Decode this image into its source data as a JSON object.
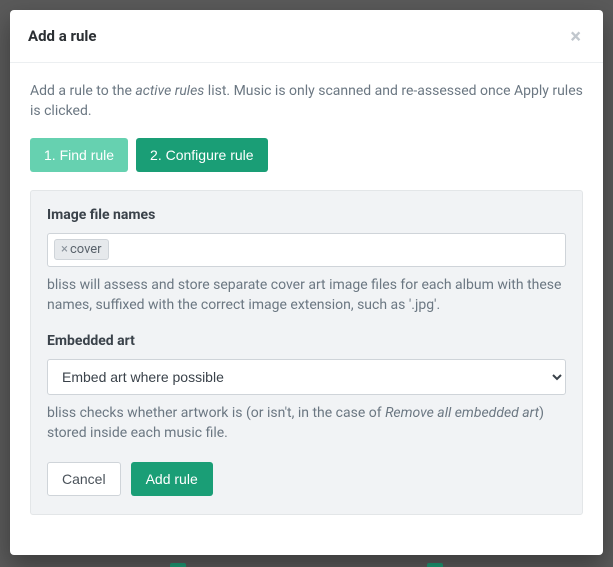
{
  "modal": {
    "title": "Add a rule",
    "close_symbol": "×",
    "intro_prefix": "Add a rule to the ",
    "intro_em": "active rules",
    "intro_suffix": " list. Music is only scanned and re-assessed once Apply rules is clicked."
  },
  "steps": {
    "find": "1. Find rule",
    "configure": "2. Configure rule"
  },
  "form": {
    "image_file_names_label": "Image file names",
    "image_file_names_token": "cover",
    "image_file_names_help": "bliss will assess and store separate cover art image files for each album with these names, suffixed with the correct image extension, such as '.jpg'.",
    "embedded_art_label": "Embedded art",
    "embedded_art_selected": "Embed art where possible",
    "embedded_art_help_prefix": "bliss checks whether artwork is (or isn't, in the case of ",
    "embedded_art_help_em": "Remove all embedded art",
    "embedded_art_help_suffix": ") stored inside each music file."
  },
  "actions": {
    "cancel": "Cancel",
    "add_rule": "Add rule"
  },
  "background": {
    "chip_left": "",
    "chip_right": ""
  }
}
